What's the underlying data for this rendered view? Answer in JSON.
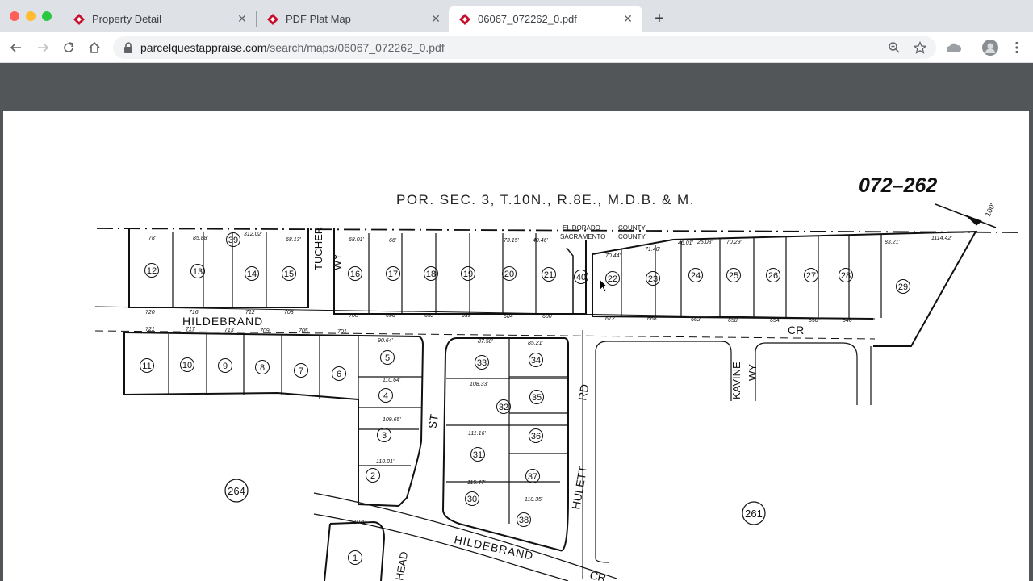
{
  "browser": {
    "tabs": [
      {
        "title": "Property Detail",
        "active": false
      },
      {
        "title": "PDF Plat Map",
        "active": false
      },
      {
        "title": "06067_072262_0.pdf",
        "active": true
      }
    ],
    "url_host": "parcelquestappraise.com",
    "url_path": "/search/maps/06067_072262_0.pdf",
    "icons": [
      "back-icon",
      "forward-icon",
      "reload-icon",
      "home-icon",
      "lock-icon",
      "zoom-icon",
      "star-icon",
      "drive-icon",
      "profile-icon",
      "menu-icon"
    ]
  },
  "map": {
    "map_number": "072–262",
    "header_line": "POR. SEC. 3, T.10N., R.8E., M.D.B. & M.",
    "county_el_dorado": "EL DORADO",
    "county_sacramento": "SACRAMENTO",
    "county_word_1": "COUNTY",
    "county_word_2": "COUNTY",
    "streets": {
      "hildebrand_top": "HILDEBRAND",
      "cr_top": "CR",
      "tucher": "TUCHER",
      "tucher_wy": "WY",
      "kavine": "KAVINE",
      "kavine_wy": "WY",
      "st": "ST",
      "hulett": "HULETT",
      "rd": "RD",
      "hildebrand_bottom": "HILDEBRAND",
      "cr_bottom": "CR",
      "head": "HEAD"
    },
    "book_refs": [
      "264",
      "261"
    ],
    "north_lots": [
      "12",
      "13",
      "39",
      "14",
      "15",
      "16",
      "17",
      "18",
      "19",
      "20",
      "21",
      "40",
      "22",
      "23",
      "24",
      "25",
      "26",
      "27",
      "28",
      "29"
    ],
    "south_lots": [
      "11",
      "10",
      "9",
      "8",
      "7",
      "6",
      "5",
      "4",
      "3",
      "2",
      "1",
      "33",
      "32",
      "31",
      "30",
      "34",
      "35",
      "36",
      "37",
      "38"
    ],
    "dim_labels": {
      "d1": "78'",
      "d2": "85.88'",
      "d3": "312.02'",
      "d4": "68.13'",
      "d5": "68.01'",
      "d6": "66'",
      "d7": "73.15'",
      "d8": "40.46'",
      "d9": "70.44'",
      "d10": "71.40'",
      "d11": "46.01'",
      "d12": "25.03'",
      "d13": "70.29'",
      "d14": "83.21'",
      "d15": "1114.42'",
      "d16": "720",
      "d17": "716",
      "d18": "712",
      "d19": "708",
      "d20": "700",
      "d21": "696",
      "d22": "692",
      "d23": "688",
      "d24": "684",
      "d25": "680",
      "d26": "672",
      "d27": "668",
      "d28": "662",
      "d29": "658",
      "d30": "654",
      "d31": "650",
      "d32": "646",
      "d33": "721",
      "d34": "717",
      "d35": "713",
      "d36": "709",
      "d37": "705",
      "d38": "701",
      "d39": "90.64'",
      "d40": "87.58'",
      "d41": "85.21'",
      "d42": "110.64'",
      "d43": "108.33'",
      "d44": "109.65'",
      "d45": "111.16'",
      "d46": "110.01'",
      "d47": "115.47'",
      "d48": "110.35'",
      "d49": "1030",
      "d50": "100'"
    }
  }
}
